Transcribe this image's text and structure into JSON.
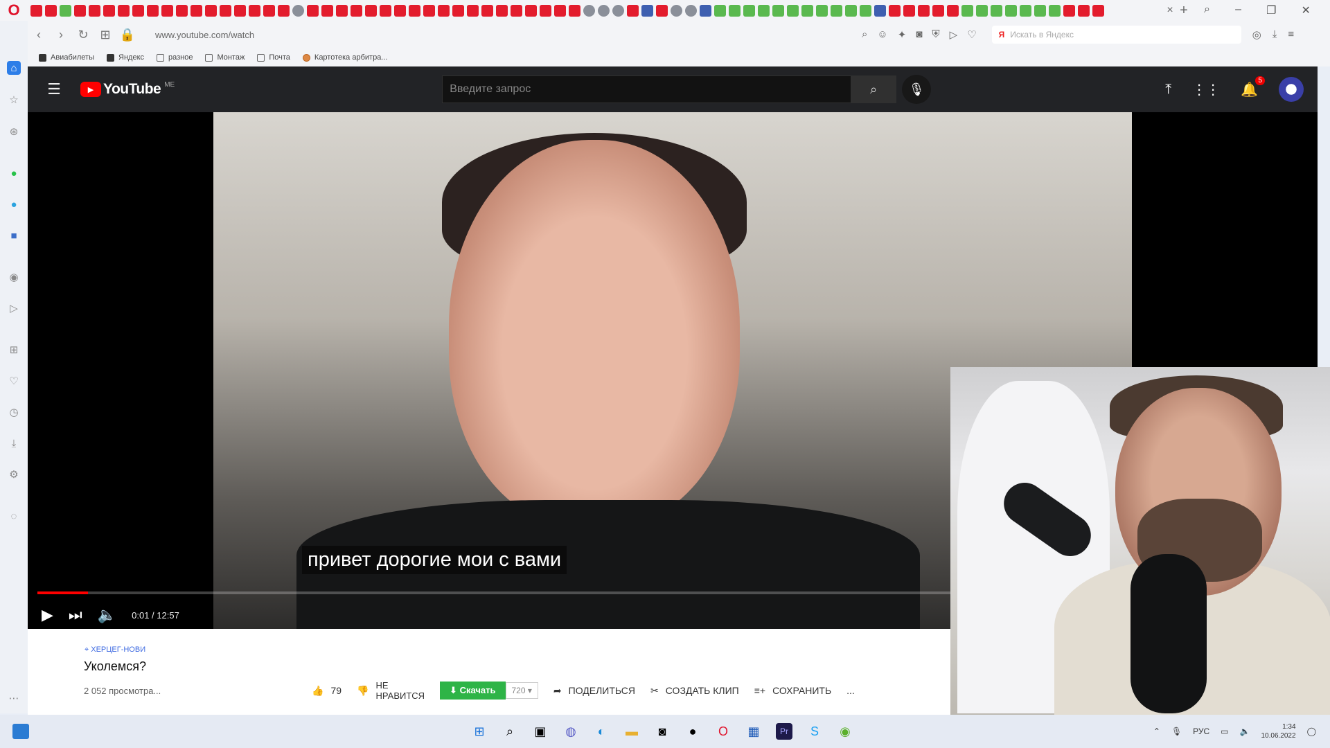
{
  "browser": {
    "url": "www.youtube.com/watch",
    "yandex_search_placeholder": "Искать в Яндекс",
    "bookmarks": [
      "Авиабилеты",
      "Яндекс",
      "разное",
      "Монтаж",
      "Почта",
      "Картотека арбитра..."
    ]
  },
  "youtube": {
    "logo_text": "YouTube",
    "country_code": "ME",
    "search_placeholder": "Введите запрос",
    "notification_count": "5"
  },
  "player": {
    "subtitle": "привет дорогие мои с вами",
    "current_time": "0:01",
    "duration": "12:57",
    "time_display": "0:01 / 12:57",
    "progress_fraction": 0.04
  },
  "video": {
    "location": "ХЕРЦЕГ-НОВИ",
    "title": "Уколемся?",
    "views": "2 052 просмотра..."
  },
  "actions": {
    "likes": "79",
    "dislike_label_line1": "НЕ",
    "dislike_label_line2": "НРАВИТСЯ",
    "download_label": "Скачать",
    "download_quality": "720",
    "share_label": "ПОДЕЛИТЬСЯ",
    "clip_label": "СОЗДАТЬ КЛИП",
    "save_label": "СОХРАНИТЬ",
    "more_label": "..."
  },
  "taskbar": {
    "language": "РУС",
    "time": "1:34",
    "date": "10.06.2022"
  }
}
